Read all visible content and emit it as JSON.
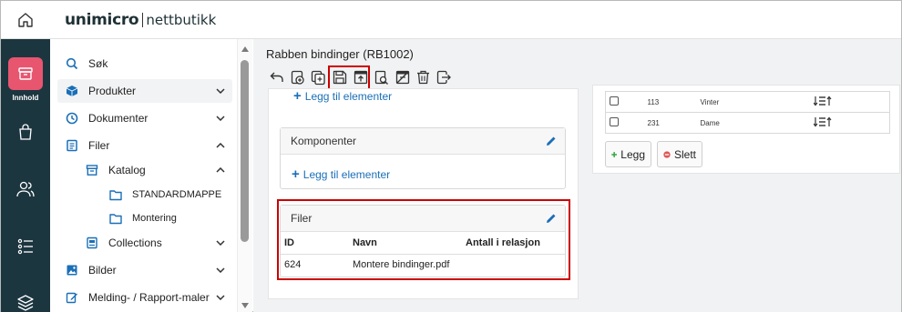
{
  "app": {
    "brand_main": "unimicro",
    "brand_sub": "nettbutikk"
  },
  "rail": {
    "active_label": "Innhold"
  },
  "nav": {
    "items": [
      {
        "label": "Søk",
        "icon": "search-icon"
      },
      {
        "label": "Produkter",
        "icon": "cube-icon",
        "chevron": "down",
        "active": true
      },
      {
        "label": "Dokumenter",
        "icon": "circle-arrow-icon",
        "chevron": "down"
      },
      {
        "label": "Filer",
        "icon": "file-icon",
        "chevron": "up"
      },
      {
        "label": "Katalog",
        "icon": "archive-icon",
        "chevron": "up"
      },
      {
        "label": "STANDARDMAPPE",
        "icon": "folder-icon"
      },
      {
        "label": "Montering",
        "icon": "folder-icon"
      },
      {
        "label": "Collections",
        "icon": "collection-icon",
        "chevron": "down"
      },
      {
        "label": "Bilder",
        "icon": "image-icon",
        "chevron": "down"
      },
      {
        "label": "Melding- / Rapport-maler",
        "icon": "edit-icon",
        "chevron": "down"
      }
    ]
  },
  "main": {
    "title": "Rabben bindinger (RB1002)",
    "add_elements_label": "Legg til elementer",
    "components_panel": {
      "title": "Komponenter",
      "add_label": "Legg til elementer"
    },
    "files_panel": {
      "title": "Filer",
      "columns": [
        "ID",
        "Navn",
        "Antall i relasjon"
      ],
      "rows": [
        {
          "id": "624",
          "name": "Montere bindinger.pdf",
          "count": ""
        }
      ]
    },
    "relations": {
      "rows": [
        {
          "id": "113",
          "name": "Vinter"
        },
        {
          "id": "231",
          "name": "Dame"
        }
      ],
      "add_button": "Legg",
      "delete_button": "Slett"
    }
  },
  "colors": {
    "rail_bg": "#1c3640",
    "rail_active": "#e8556f",
    "link": "#1a6fb7",
    "highlight": "#cc0000"
  }
}
